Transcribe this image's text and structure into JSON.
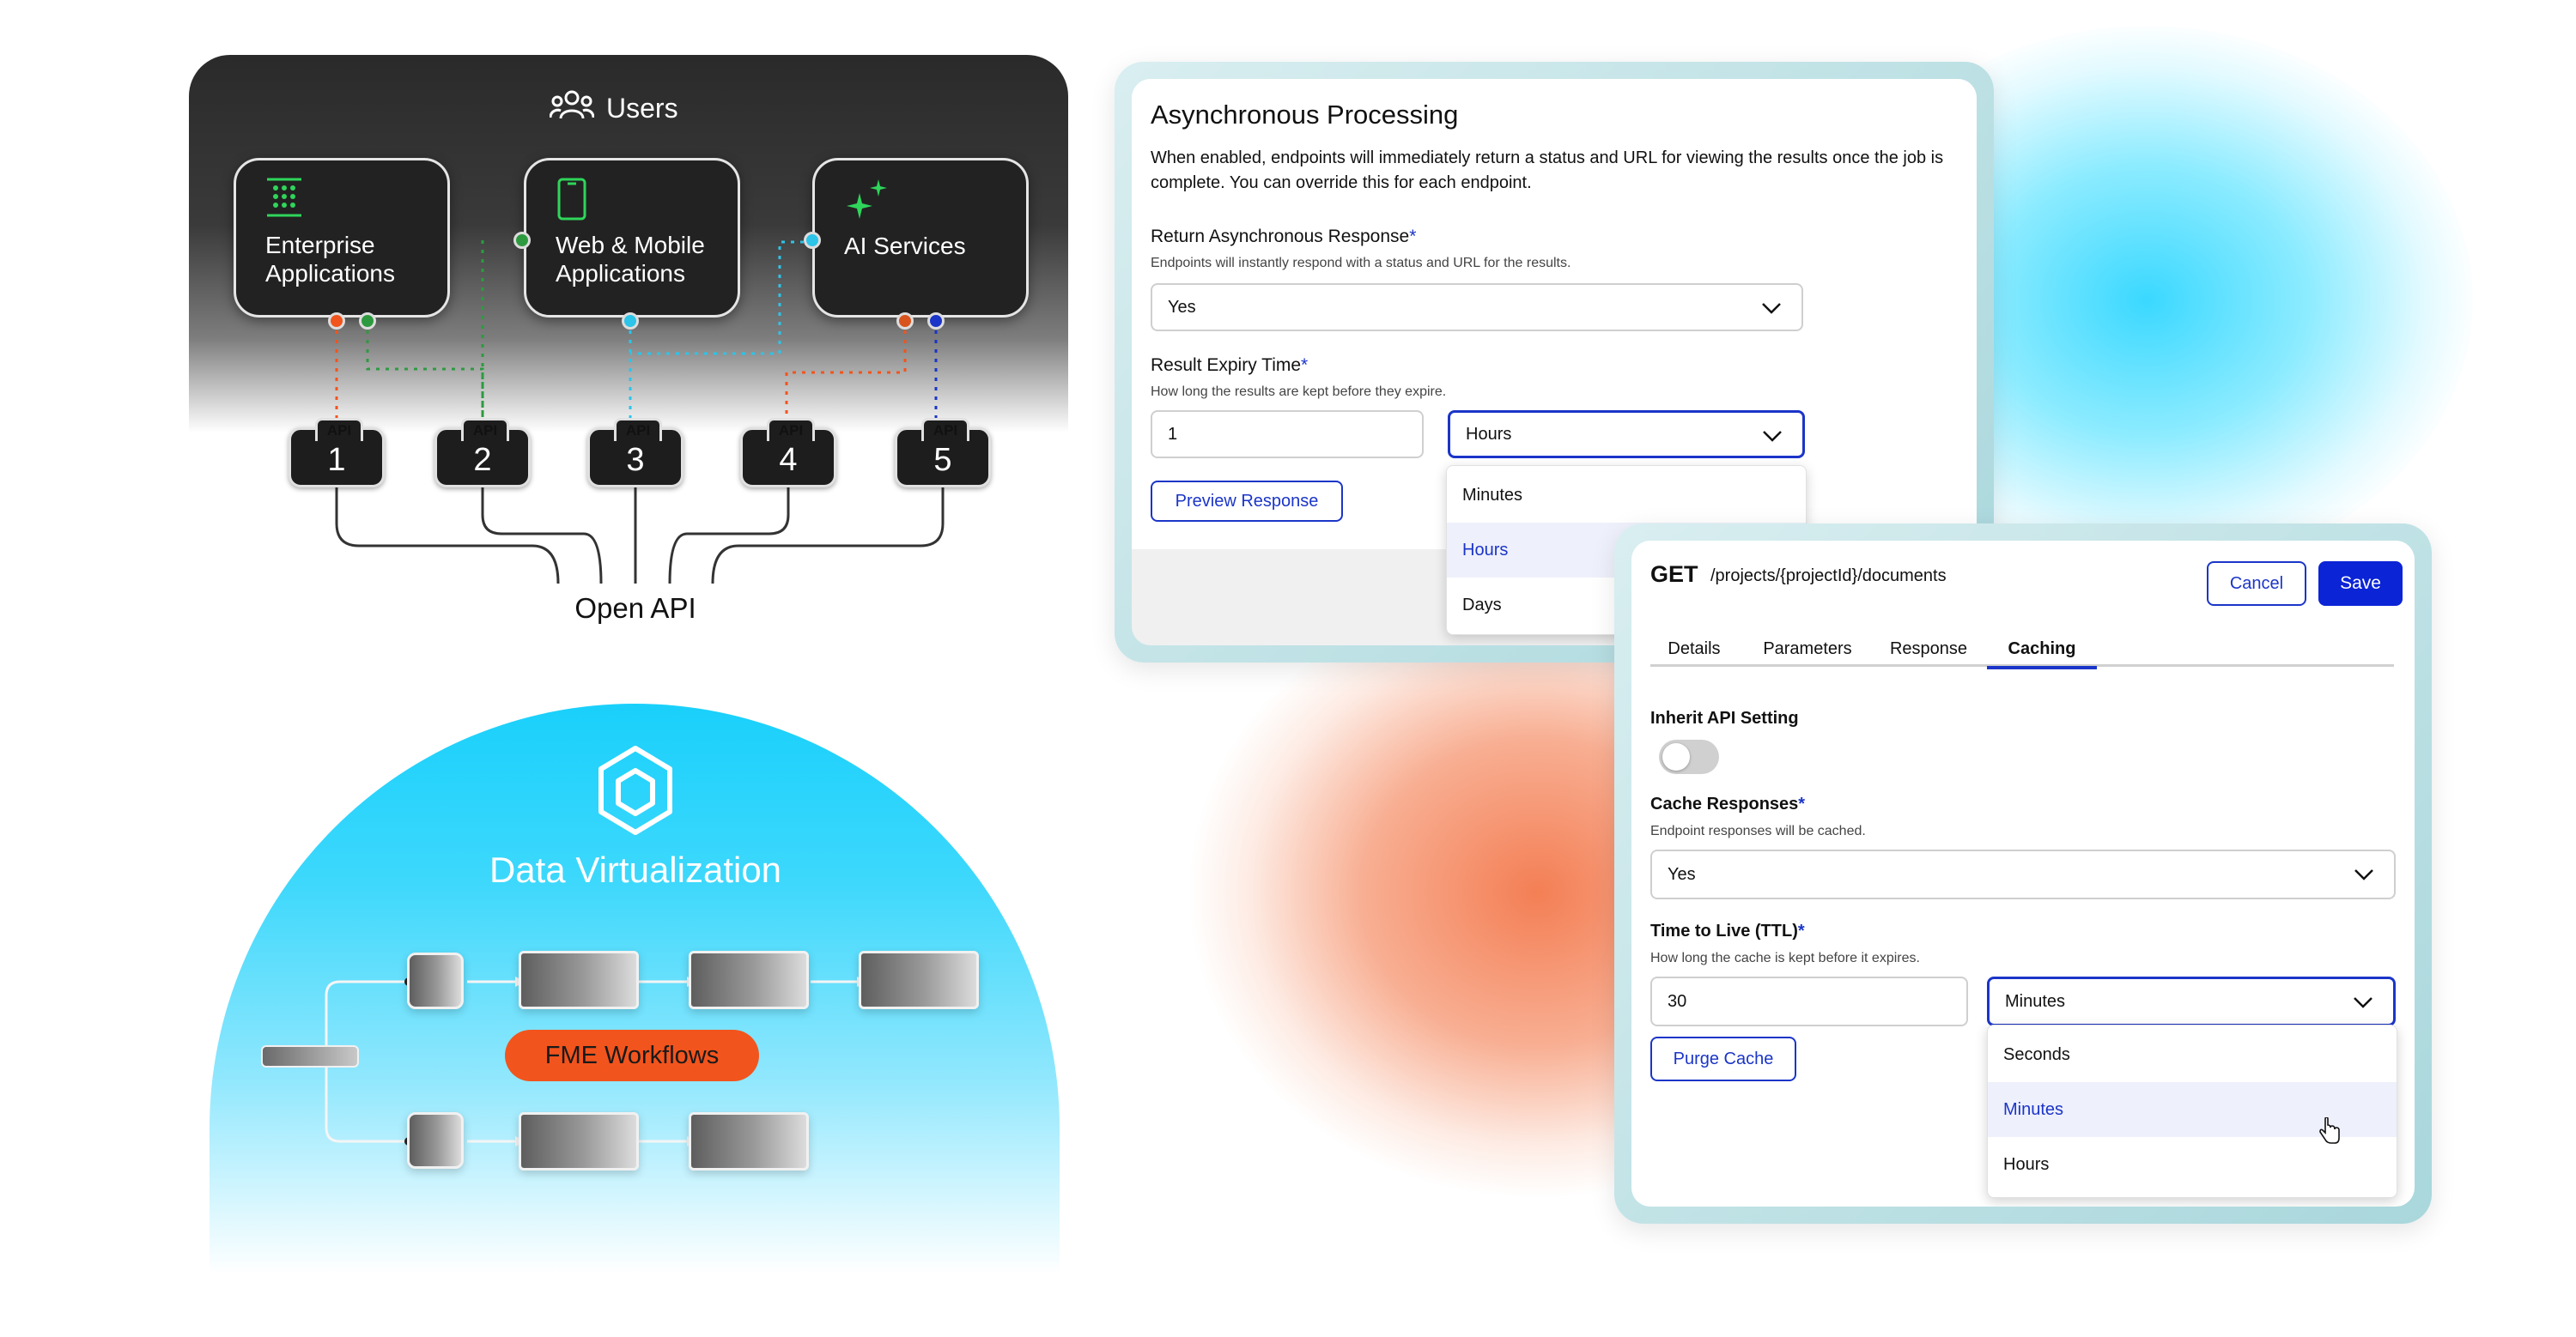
{
  "diagram": {
    "users_title": "Users",
    "apps": [
      {
        "label": "Enterprise\nApplications",
        "icon": "grid-icon"
      },
      {
        "label": "Web & Mobile\nApplications",
        "icon": "phone-icon"
      },
      {
        "label": "AI Services",
        "icon": "sparkle-icon"
      }
    ],
    "api_badges": [
      {
        "tab": "API",
        "num": "1"
      },
      {
        "tab": "API",
        "num": "2"
      },
      {
        "tab": "API",
        "num": "3"
      },
      {
        "tab": "API",
        "num": "4"
      },
      {
        "tab": "API",
        "num": "5"
      }
    ],
    "open_api": "Open API",
    "data_virtualization": "Data Virtualization",
    "fme_workflows": "FME Workflows",
    "colors": {
      "cyan": "#19d0fb",
      "orange": "#f2541d",
      "green": "#2fd55b"
    }
  },
  "async_panel": {
    "title": "Asynchronous Processing",
    "description": "When enabled, endpoints will immediately return a status and URL for viewing the results once the job is complete. You can override this for each endpoint.",
    "return_label": "Return Asynchronous Response",
    "return_hint": "Endpoints will instantly respond with a status and URL for the results.",
    "return_value": "Yes",
    "expiry_label": "Result Expiry Time",
    "expiry_hint": "How long the results are kept before they expire.",
    "expiry_value": "1",
    "expiry_unit": "Hours",
    "unit_options": [
      "Minutes",
      "Hours",
      "Days"
    ],
    "preview_button": "Preview Response",
    "required_mark": "*"
  },
  "endpoint_panel": {
    "method": "GET",
    "path": "/projects/{projectId}/documents",
    "cancel": "Cancel",
    "save": "Save",
    "tabs": [
      "Details",
      "Parameters",
      "Response",
      "Caching"
    ],
    "active_tab": "Caching",
    "inherit_label": "Inherit API Setting",
    "inherit_on": false,
    "cache_label": "Cache Responses",
    "cache_hint": "Endpoint responses will be cached.",
    "cache_value": "Yes",
    "ttl_label": "Time to Live (TTL)",
    "ttl_hint": "How long the cache is kept before it expires.",
    "ttl_value": "30",
    "ttl_unit": "Minutes",
    "ttl_options": [
      "Seconds",
      "Minutes",
      "Hours"
    ],
    "purge_button": "Purge Cache",
    "required_mark": "*"
  }
}
